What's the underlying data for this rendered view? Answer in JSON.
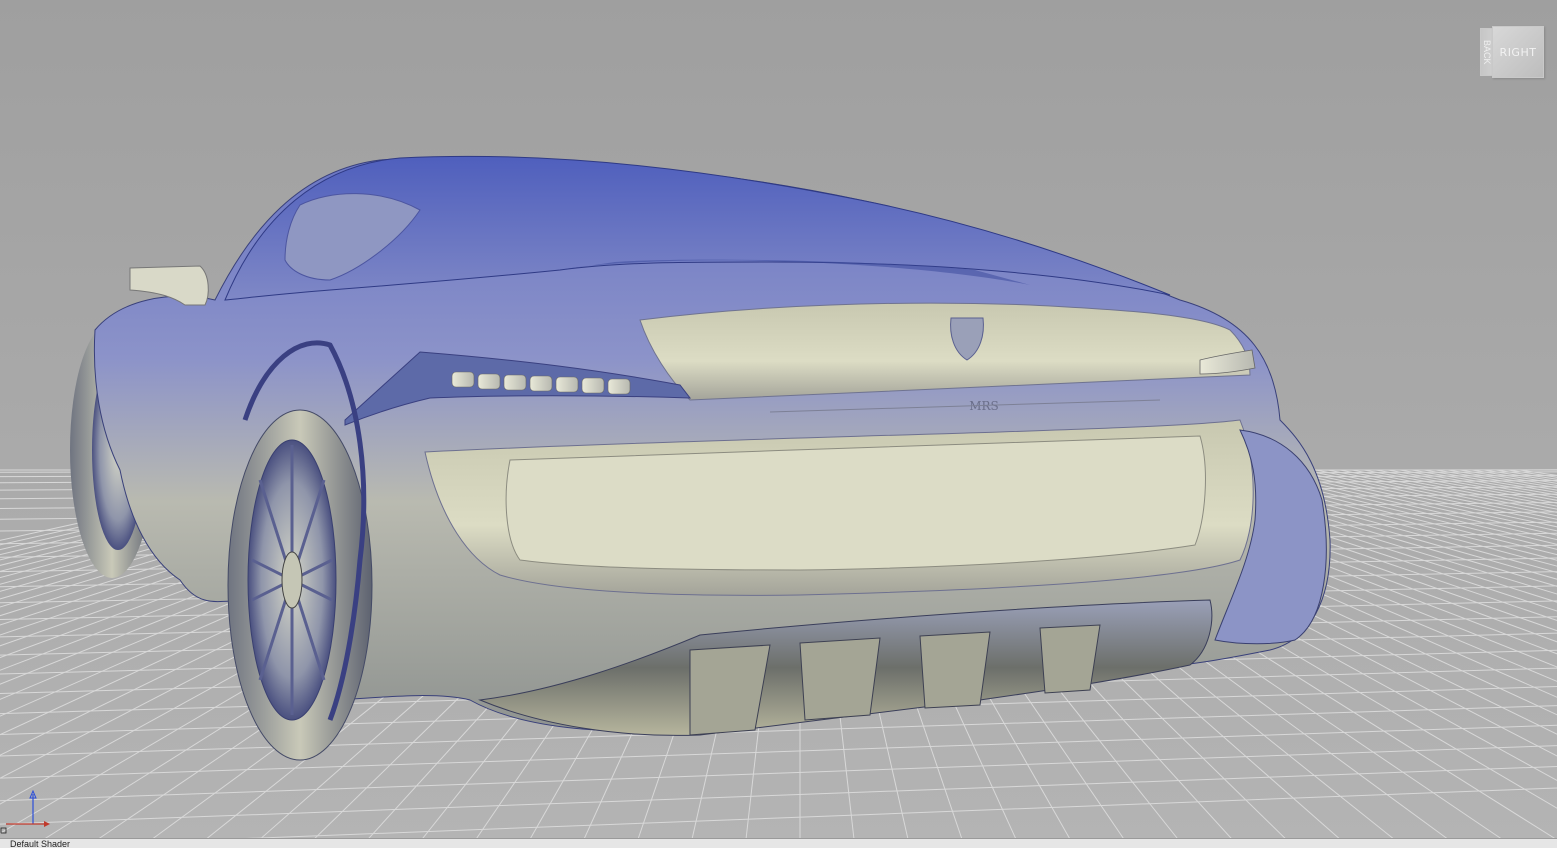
{
  "viewport": {
    "background_color": "#a8a8a8",
    "grid_color": "#d8d8d8"
  },
  "model": {
    "type": "rear three-quarter view of a sports car surface model",
    "body_highlight": "#7480c8",
    "body_lowlight": "#c9c9a8",
    "rear_badge": "MRS"
  },
  "viewcube": {
    "face_label": "RIGHT",
    "side_label": "BACK"
  },
  "axis_triad": {
    "icon": "xyz-axis-icon",
    "x_color": "#c0392b",
    "z_color": "#2d4fd8"
  },
  "status_bar": {
    "text": "Default Shader"
  }
}
